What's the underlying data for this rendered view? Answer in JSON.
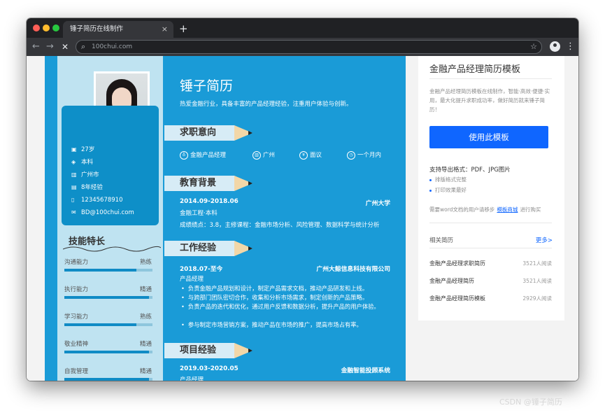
{
  "browser": {
    "tab_title": "锤子简历在线制作",
    "tab_close": "×",
    "new_tab": "+",
    "url": "100chui.com",
    "back": "←",
    "forward": "→",
    "stop": "✕",
    "star": "☆",
    "menu": "⋮"
  },
  "resume": {
    "name": "锤子简历",
    "tagline": "热爱金融行业，具备丰富的产品经理经验，注重用户体验与创新。",
    "info": [
      {
        "icon": "calendar-icon",
        "glyph": "▣",
        "text": "27岁"
      },
      {
        "icon": "education-icon",
        "glyph": "◈",
        "text": "本科"
      },
      {
        "icon": "building-icon",
        "glyph": "▥",
        "text": "广州市"
      },
      {
        "icon": "document-icon",
        "glyph": "▤",
        "text": "8年经验"
      },
      {
        "icon": "phone-icon",
        "glyph": "▯",
        "text": "12345678910"
      },
      {
        "icon": "mail-icon",
        "glyph": "✉",
        "text": "BD@100chui.com"
      }
    ],
    "skills_title": "技能特长",
    "skills": [
      {
        "name": "沟通能力",
        "level": "熟练",
        "fill": 0.82
      },
      {
        "name": "执行能力",
        "level": "精通",
        "fill": 0.96
      },
      {
        "name": "学习能力",
        "level": "熟练",
        "fill": 0.82
      },
      {
        "name": "敬业精神",
        "level": "精通",
        "fill": 0.96
      },
      {
        "name": "自我管理",
        "level": "精通",
        "fill": 0.96
      }
    ],
    "sections": {
      "intent": "求职意向",
      "education": "教育背景",
      "work": "工作经验",
      "project": "项目经验"
    },
    "intent_items": [
      {
        "icon": "medal-icon",
        "glyph": "♁",
        "text": "金融产品经理"
      },
      {
        "icon": "city-icon",
        "glyph": "▥",
        "text": "广州"
      },
      {
        "icon": "salary-icon",
        "glyph": "¥",
        "text": "面议"
      },
      {
        "icon": "clock-icon",
        "glyph": "◷",
        "text": "一个月内"
      }
    ],
    "education": {
      "period": "2014.09-2018.06",
      "school": "广州大学",
      "major": "金融工程·本科",
      "details": "成绩绩点：3.8，主修课程：金融市场分析、风险管理、数据科学与统计分析"
    },
    "work": {
      "period": "2018.07-至今",
      "company": "广州大鲸信息科技有限公司",
      "role": "产品经理",
      "bullets": [
        "负责金融产品规划和设计，制定产品需求文档，推动产品研发和上线。",
        "与跨部门团队密切合作，收集和分析市场需求，制定创新的产品策略。",
        "负责产品的迭代和优化，通过用户反馈和数据分析，提升产品的用户体验。",
        "参与制定市场营销方案，推动产品在市场的推广，提高市场占有率。"
      ]
    },
    "project": {
      "period": "2019.03-2020.05",
      "name": "金融智能投顾系统",
      "role": "产品经理"
    }
  },
  "sidebar": {
    "title": "金融产品经理简历模板",
    "description": "金融产品经理简历模板在线制作，智能·高效·便捷·实用，最大化提升求职成功率，做好简历就来锤子简历！",
    "use_button": "使用此模板",
    "formats": "支持导出格式：PDF、JPG图片",
    "features": [
      "排版格式完整",
      "打印效果最好"
    ],
    "word_note_before": "需要word文档的用户请移步",
    "word_link": "模板商城",
    "word_note_after": "进行购买",
    "related_title": "相关简历",
    "more": "更多>",
    "related": [
      {
        "title": "金融产品经理求职简历",
        "reads": "3521人阅读"
      },
      {
        "title": "金融产品经理简历",
        "reads": "3521人阅读"
      },
      {
        "title": "金融产品经理简历模板",
        "reads": "2929人阅读"
      }
    ]
  },
  "watermark": "CSDN @锤子简历"
}
